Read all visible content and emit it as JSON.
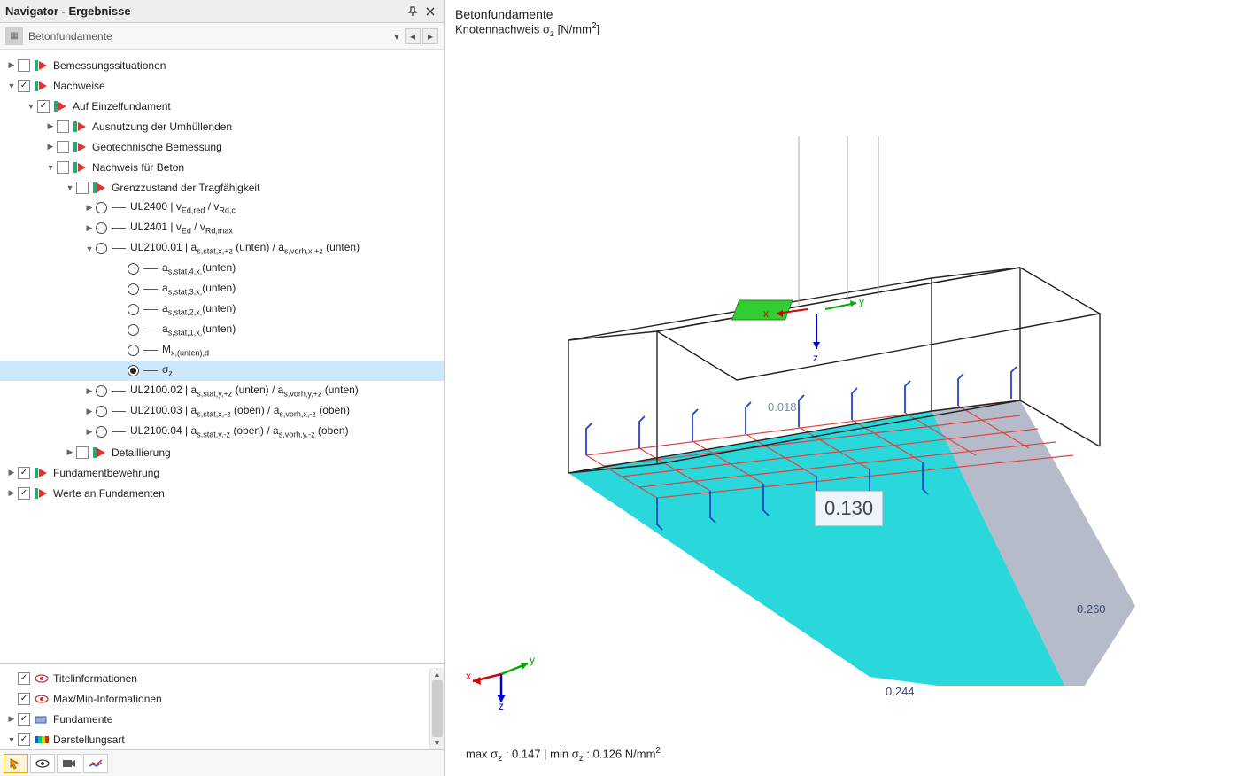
{
  "panel": {
    "title": "Navigator - Ergebnisse"
  },
  "breadcrumb": {
    "text": "Betonfundamente"
  },
  "tree": {
    "n1": "Bemessungssituationen",
    "n2": "Nachweise",
    "n3": "Auf Einzelfundament",
    "n4": "Ausnutzung der Umhüllenden",
    "n5": "Geotechnische Bemessung",
    "n6": "Nachweis für Beton",
    "n7": "Grenzzustand der Tragfähigkeit",
    "n8": "UL2400 | v",
    "n8b": " / v",
    "n8s1": "Ed,red",
    "n8s2": "Rd,c",
    "n9": "UL2401 | v",
    "n9b": " / v",
    "n9s1": "Ed",
    "n9s2": "Rd,max",
    "n10": "UL2100.01 | a",
    "n10s1": "s,stat,x,+z",
    "n10m": " (unten) / a",
    "n10s2": "s,vorh,x,+z",
    "n10e": " (unten)",
    "n11": "a",
    "n11s": "s,stat,4,x,",
    "n11e": "(unten)",
    "n12": "a",
    "n12s": "s,stat,3,x,",
    "n12e": "(unten)",
    "n13": "a",
    "n13s": "s,stat,2,x,",
    "n13e": "(unten)",
    "n14": "a",
    "n14s": "s,stat,1,x,",
    "n14e": "(unten)",
    "n15": "M",
    "n15s": "x,(unten),d",
    "n16": "σ",
    "n16s": "z",
    "n17": "UL2100.02 | a",
    "n17s1": "s,stat,y,+z",
    "n17m": " (unten) / a",
    "n17s2": "s,vorh,y,+z",
    "n17e": " (unten)",
    "n18": "UL2100.03 | a",
    "n18s1": "s,stat,x,-z",
    "n18m": " (oben) / a",
    "n18s2": "s,vorh,x,-z",
    "n18e": " (oben)",
    "n19": "UL2100.04 | a",
    "n19s1": "s,stat,y,-z",
    "n19m": " (oben) / a",
    "n19s2": "s,vorh,y,-z",
    "n19e": " (oben)",
    "n20": "Detaillierung",
    "n21": "Fundamentbewehrung",
    "n22": "Werte an Fundamenten"
  },
  "bottom": {
    "b1": "Titelinformationen",
    "b2": "Max/Min-Informationen",
    "b3": "Fundamente",
    "b4": "Darstellungsart"
  },
  "right": {
    "title1": "Betonfundamente",
    "title2a": "Knotennachweis σ",
    "title2sub": "z",
    "title2b": " [N/mm",
    "title2sup": "2",
    "title2c": "]",
    "callout": "0.130",
    "v1": "0.018",
    "v2": "0.260",
    "v3": "0.244",
    "ax_x": "x",
    "ax_y": "y",
    "ax_z": "z",
    "status_a": "max σ",
    "status_sub1": "z",
    "status_b": " : 0.147 | min σ",
    "status_sub2": "z",
    "status_c": " : 0.126 N/mm",
    "status_sup": "2"
  }
}
